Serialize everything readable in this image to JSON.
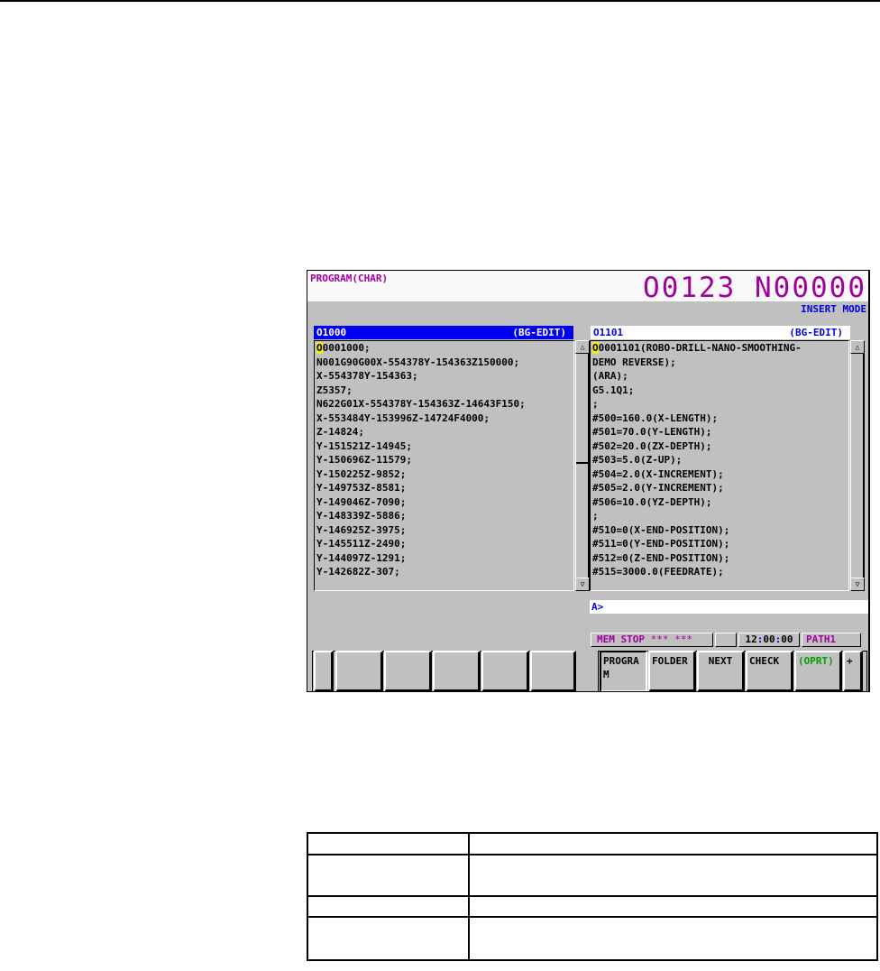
{
  "screen": {
    "title": "PROGRAM(CHAR)",
    "program_number": "O0123 N00000",
    "mode": "INSERT MODE",
    "left_pane": {
      "program": "O1000",
      "status": "(BG-EDIT)",
      "cursor_char": "O",
      "lines": [
        "00001000;",
        "N001G90G00X-554378Y-154363Z150000;",
        "X-554378Y-154363;",
        "Z5357;",
        "N622G01X-554378Y-154363Z-14643F150;",
        "X-553484Y-153996Z-14724F4000;",
        "Z-14824;",
        "Y-151521Z-14945;",
        "Y-150696Z-11579;",
        "Y-150225Z-9852;",
        "Y-149753Z-8581;",
        "Y-149046Z-7090;",
        "Y-148339Z-5886;",
        "Y-146925Z-3975;",
        "Y-145511Z-2490;",
        "Y-144097Z-1291;",
        "Y-142682Z-307;"
      ],
      "scroll_up_icon": "△",
      "scroll_down_icon": "▽"
    },
    "right_pane": {
      "program": "O1101",
      "status": "(BG-EDIT)",
      "cursor_char": "O",
      "lines": [
        "00001101(ROBO-DRILL-NANO-SMOOTHING-",
        "DEMO REVERSE);",
        "(ARA);",
        "G5.1Q1;",
        ";",
        "#500=160.0(X-LENGTH);",
        "#501=70.0(Y-LENGTH);",
        "#502=20.0(ZX-DEPTH);",
        "#503=5.0(Z-UP);",
        "#504=2.0(X-INCREMENT);",
        "#505=2.0(Y-INCREMENT);",
        "#506=10.0(YZ-DEPTH);",
        ";",
        "#510=0(X-END-POSITION);",
        "#511=0(Y-END-POSITION);",
        "#512=0(Z-END-POSITION);",
        "#515=3000.0(FEEDRATE);"
      ],
      "scroll_up_icon": "△",
      "scroll_down_icon": "▽"
    },
    "input_prompt": "A>",
    "status": {
      "mode": "MEM  STOP",
      "alarm": "*** ***",
      "time_h": "12",
      "time_m": "00",
      "time_s": "00",
      "path": "PATH1"
    },
    "softkeys": {
      "program": "PROGRAM",
      "folder": "FOLDER",
      "next": "NEXT",
      "check": "CHECK",
      "operation": "(OPRT)",
      "more": "+"
    },
    "colors": {
      "title_magenta": "#a000a0",
      "mode_blue": "#0000e0",
      "header_blue": "#0000f0",
      "screen_gray": "#c0c0c0",
      "cursor_yellow": "#f0f000",
      "oprt_green": "#00a000"
    }
  },
  "table": {
    "rows": [
      [
        "",
        ""
      ],
      [
        "",
        ""
      ],
      [
        "",
        ""
      ],
      [
        "",
        ""
      ]
    ]
  }
}
